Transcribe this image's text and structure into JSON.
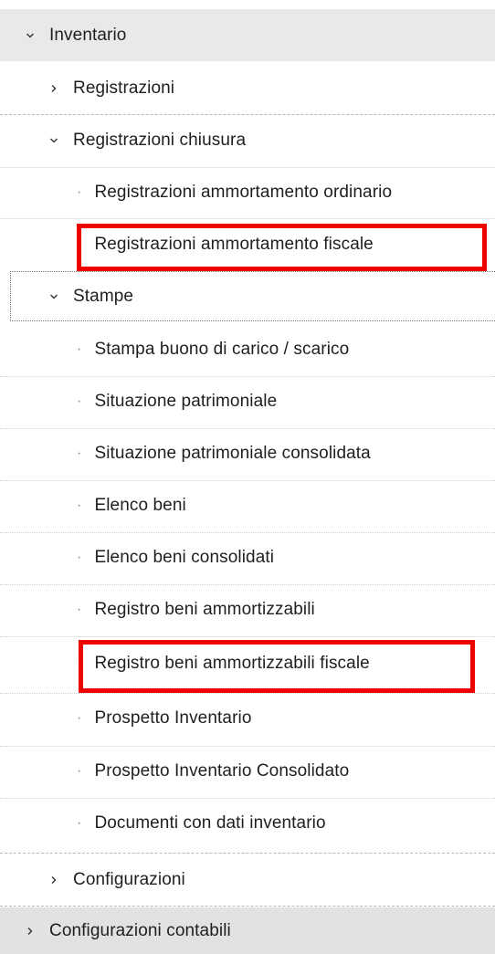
{
  "menu": {
    "inventario": {
      "label": "Inventario",
      "icon": "chevron-down-icon"
    },
    "registrazioni": {
      "label": "Registrazioni",
      "icon": "chevron-right-icon"
    },
    "registrazioni_chiusura": {
      "label": "Registrazioni chiusura",
      "icon": "chevron-down-icon",
      "items": [
        {
          "label": "Registrazioni ammortamento ordinario"
        },
        {
          "label": "Registrazioni ammortamento fiscale",
          "highlighted": true
        }
      ]
    },
    "stampe": {
      "label": "Stampe",
      "icon": "chevron-down-icon",
      "items": [
        {
          "label": "Stampa buono di carico / scarico"
        },
        {
          "label": "Situazione patrimoniale"
        },
        {
          "label": "Situazione patrimoniale consolidata"
        },
        {
          "label": "Elenco beni"
        },
        {
          "label": "Elenco beni consolidati"
        },
        {
          "label": "Registro beni ammortizzabili"
        },
        {
          "label": "Registro beni ammortizzabili fiscale",
          "highlighted": true
        },
        {
          "label": "Prospetto Inventario"
        },
        {
          "label": "Prospetto Inventario Consolidato"
        },
        {
          "label": "Documenti con dati inventario"
        }
      ]
    },
    "configurazioni": {
      "label": "Configurazioni",
      "icon": "chevron-right-icon"
    },
    "configurazioni_contabili": {
      "label": "Configurazioni contabili",
      "icon": "chevron-right-icon"
    }
  },
  "colors": {
    "highlight": "#ee0000",
    "section_bg": "#e9e9e9",
    "text": "#1f1f1f"
  }
}
